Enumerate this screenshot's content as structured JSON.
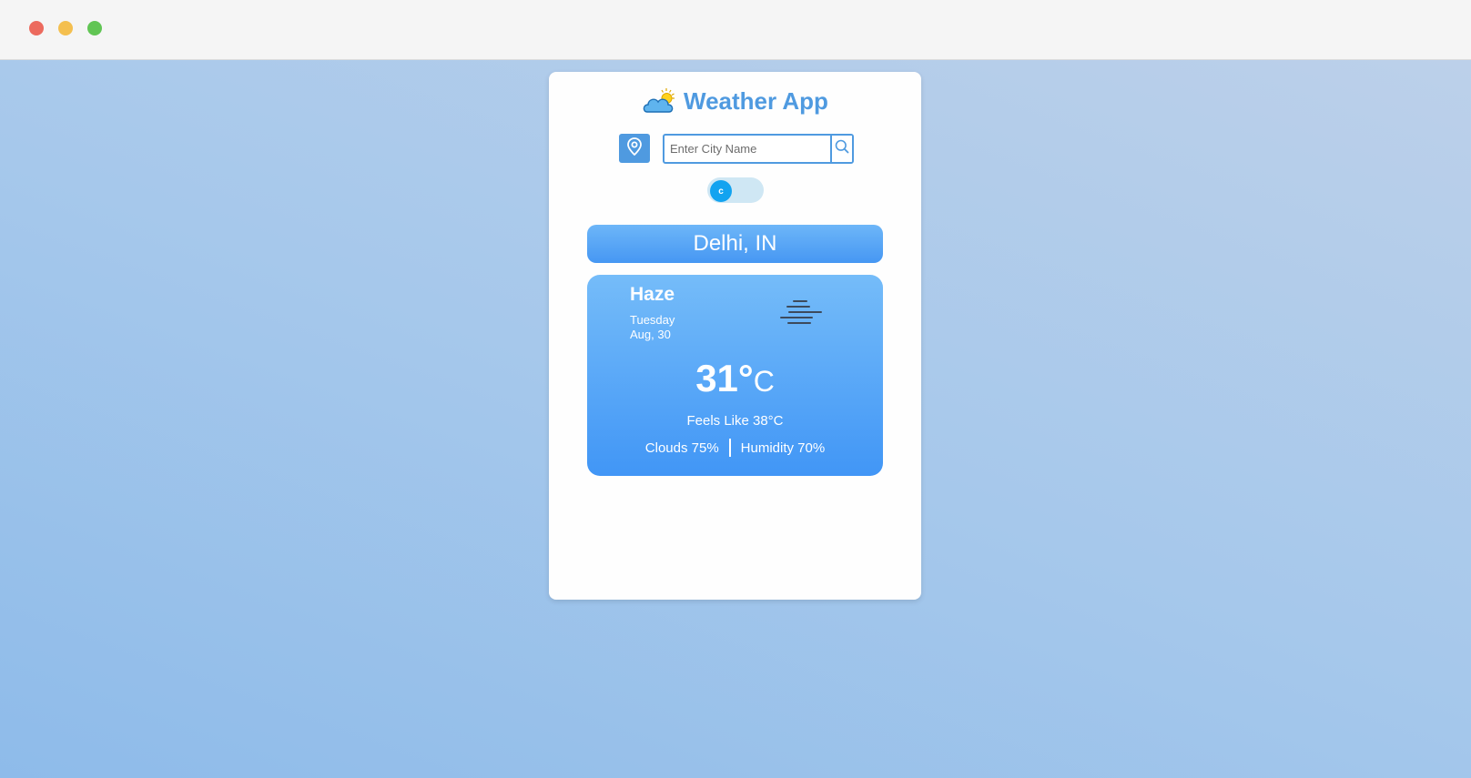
{
  "window": {
    "controls": [
      "close",
      "minimize",
      "maximize"
    ]
  },
  "app": {
    "title": "Weather App",
    "logo_icon": "cloud-sun-icon",
    "accent_color": "#4f9ae0"
  },
  "search": {
    "location_icon": "location-pin-icon",
    "placeholder": "Enter City Name",
    "value": "",
    "search_icon": "search-icon"
  },
  "unit_toggle": {
    "label": "c",
    "state": "celsius"
  },
  "location": {
    "name": "Delhi, IN"
  },
  "weather": {
    "condition": "Haze",
    "condition_icon": "haze-icon",
    "day": "Tuesday",
    "date": "Aug, 30",
    "temperature": "31°",
    "unit": "C",
    "feels_like": "Feels Like 38°C",
    "clouds": "Clouds 75%",
    "humidity": "Humidity 70%"
  }
}
